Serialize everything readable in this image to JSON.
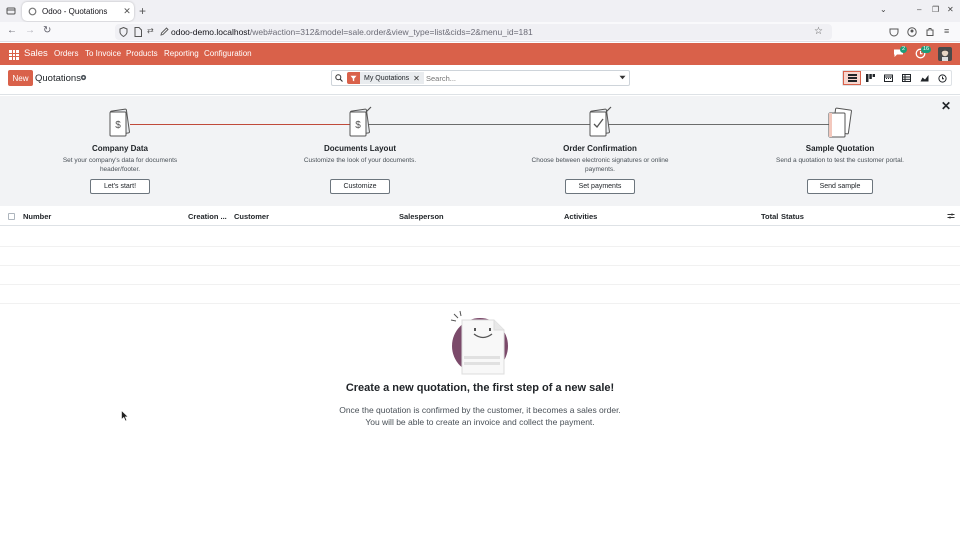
{
  "browser": {
    "tab_title": "Odoo - Quotations",
    "tab_close": "✕",
    "new_tab": "+",
    "url_host": "odoo-demo.localhost",
    "url_path": "/web#action=312&model=sale.order&view_type=list&cids=2&menu_id=181"
  },
  "appbar": {
    "app_name": "Sales",
    "menu": [
      "Orders",
      "To Invoice",
      "Products",
      "Reporting",
      "Configuration"
    ],
    "messages_count": "2",
    "activities_count": "16",
    "accent": "#d9614a"
  },
  "control_panel": {
    "new_label": "New",
    "breadcrumb": "Quotations",
    "facet_label": "My Quotations",
    "facet_remove": "✕",
    "search_placeholder": "Search..."
  },
  "onboarding": {
    "close": "✕",
    "steps": [
      {
        "title": "Company Data",
        "desc": "Set your company's data for documents header/footer.",
        "button": "Let's start!"
      },
      {
        "title": "Documents Layout",
        "desc": "Customize the look of your documents.",
        "button": "Customize"
      },
      {
        "title": "Order Confirmation",
        "desc": "Choose between electronic signatures or online payments.",
        "button": "Set payments"
      },
      {
        "title": "Sample Quotation",
        "desc": "Send a quotation to test the customer portal.",
        "button": "Send sample"
      }
    ]
  },
  "list": {
    "columns": [
      "Number",
      "Creation ...",
      "Customer",
      "Salesperson",
      "Activities",
      "Total",
      "Status"
    ]
  },
  "empty_state": {
    "title": "Create a new quotation, the first step of a new sale!",
    "line1": "Once the quotation is confirmed by the customer, it becomes a sales order.",
    "line2": "You will be able to create an invoice and collect the payment."
  }
}
